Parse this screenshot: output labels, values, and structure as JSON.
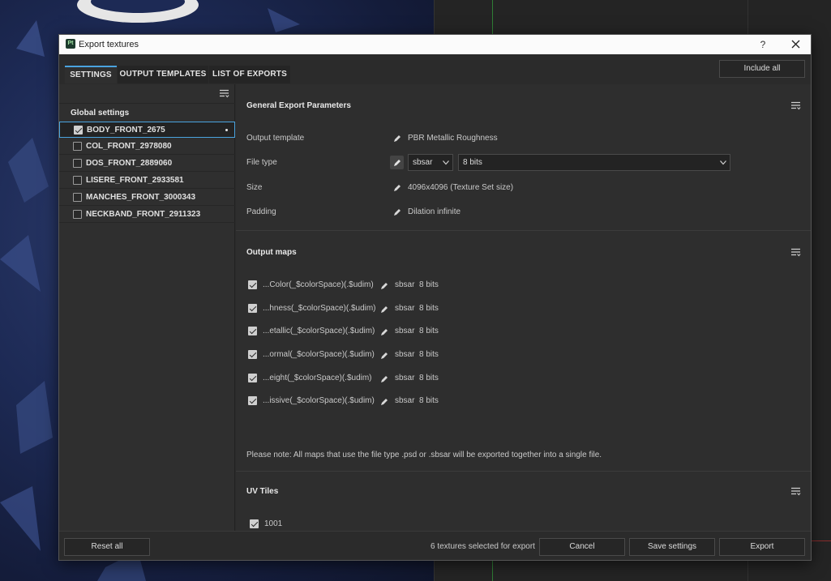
{
  "window": {
    "title": "Export textures",
    "logo": "Pt",
    "help_label": "?"
  },
  "tabs": [
    {
      "label": "SETTINGS",
      "active": true
    },
    {
      "label": "OUTPUT TEMPLATES",
      "active": false
    },
    {
      "label": "LIST OF EXPORTS",
      "active": false
    }
  ],
  "include_all_label": "Include all",
  "left_panel": {
    "heading": "Global settings",
    "texture_sets": [
      {
        "label": "BODY_FRONT_2675",
        "checked": true,
        "selected": true
      },
      {
        "label": "COL_FRONT_2978080",
        "checked": false
      },
      {
        "label": "DOS_FRONT_2889060",
        "checked": false
      },
      {
        "label": "LISERE_FRONT_2933581",
        "checked": false
      },
      {
        "label": "MANCHES_FRONT_3000343",
        "checked": false
      },
      {
        "label": "NECKBAND_FRONT_2911323",
        "checked": false
      }
    ]
  },
  "general": {
    "title": "General Export Parameters",
    "output_template_label": "Output template",
    "output_template_value": "PBR Metallic Roughness",
    "file_type_label": "File type",
    "file_type_value": "sbsar",
    "bit_depth_value": "8 bits",
    "size_label": "Size",
    "size_value": "4096x4096 (Texture Set size)",
    "padding_label": "Padding",
    "padding_value": "Dilation infinite"
  },
  "output_maps": {
    "title": "Output maps",
    "maps": [
      {
        "name": "...Color(_$colorSpace)(.$udim)",
        "format": "sbsar",
        "bits": "8 bits",
        "checked": true
      },
      {
        "name": "...hness(_$colorSpace)(.$udim)",
        "format": "sbsar",
        "bits": "8 bits",
        "checked": true
      },
      {
        "name": "...etallic(_$colorSpace)(.$udim)",
        "format": "sbsar",
        "bits": "8 bits",
        "checked": true
      },
      {
        "name": "...ormal(_$colorSpace)(.$udim)",
        "format": "sbsar",
        "bits": "8 bits",
        "checked": true
      },
      {
        "name": "...eight(_$colorSpace)(.$udim)",
        "format": "sbsar",
        "bits": "8 bits",
        "checked": true
      },
      {
        "name": "...issive(_$colorSpace)(.$udim)",
        "format": "sbsar",
        "bits": "8 bits",
        "checked": true
      }
    ],
    "note": "Please note: All maps that use the file type .psd or .sbsar will be exported together into a single file."
  },
  "uv_tiles": {
    "title": "UV Tiles",
    "tiles": [
      {
        "label": "1001",
        "checked": true
      }
    ]
  },
  "footer": {
    "reset_label": "Reset all",
    "selected_count": "6 textures selected for export",
    "cancel_label": "Cancel",
    "save_label": "Save settings",
    "export_label": "Export"
  },
  "colors": {
    "accent": "#4aa3df",
    "panel": "#2e2e2e",
    "titlebar": "#fbfbfb"
  }
}
